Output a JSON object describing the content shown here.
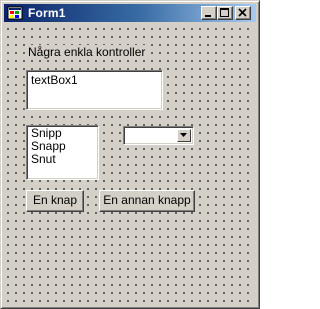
{
  "window": {
    "title": "Form1",
    "caption_buttons": [
      "minimize-icon",
      "maximize-icon",
      "close-icon"
    ]
  },
  "form": {
    "label_text": "Några enkla kontroller",
    "textbox_value": "textBox1",
    "listbox_items": [
      "Snipp",
      "Snapp",
      "Snut"
    ],
    "combobox_value": "",
    "button1_label": "En knap",
    "button2_label": "En annan knapp"
  },
  "colors": {
    "titlebar_start": "#0a246a",
    "titlebar_end": "#a6caf0",
    "face": "#d4d0c8"
  }
}
